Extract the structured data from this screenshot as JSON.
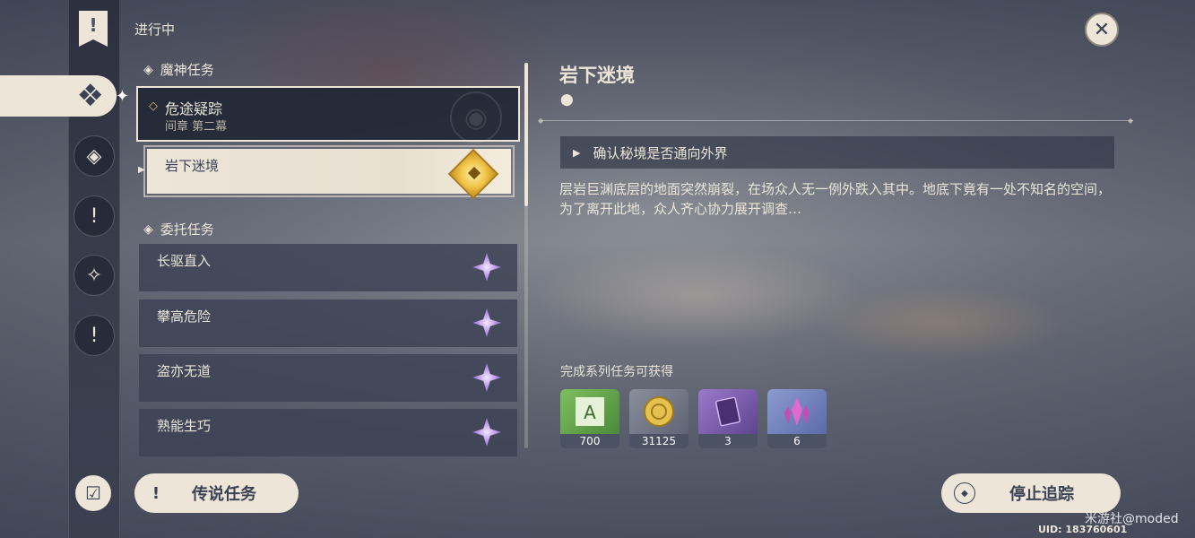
{
  "status": "进行中",
  "sections": {
    "archon": {
      "title": "魔神任务"
    },
    "commission": {
      "title": "委托任务"
    }
  },
  "main_quest": {
    "name": "危途疑踪",
    "chapter": "间章 第二幕",
    "sub_quest": "岩下迷境"
  },
  "commissions": [
    {
      "name": "长驱直入"
    },
    {
      "name": "攀高危险"
    },
    {
      "name": "盗亦无道"
    },
    {
      "name": "熟能生巧"
    }
  ],
  "legend_button": "传说任务",
  "detail": {
    "title": "岩下迷境",
    "objective": "确认秘境是否通向外界",
    "description": "层岩巨渊底层的地面突然崩裂，在场众人无一例外跌入其中。地底下竟有一处不知名的空间，为了离开此地，众人齐心协力展开调查…",
    "reward_label": "完成系列任务可获得",
    "rewards": [
      {
        "icon": "adventure-exp-icon",
        "count": "700",
        "color": "#6aa84f"
      },
      {
        "icon": "mora-icon",
        "count": "31125",
        "color": "#c9a640"
      },
      {
        "icon": "heros-wit-icon",
        "count": "3",
        "color": "#7a5aa8"
      },
      {
        "icon": "crystal-icon",
        "count": "6",
        "color": "#6a7bb8"
      }
    ]
  },
  "stop_button": "停止追踪",
  "watermark": "米游社@moded",
  "uid": "UID: 183760601",
  "colors": {
    "cream": "#ece5d8",
    "dark": "#3b4255",
    "gold": "#d6b66b",
    "purple": "#b48be6"
  }
}
